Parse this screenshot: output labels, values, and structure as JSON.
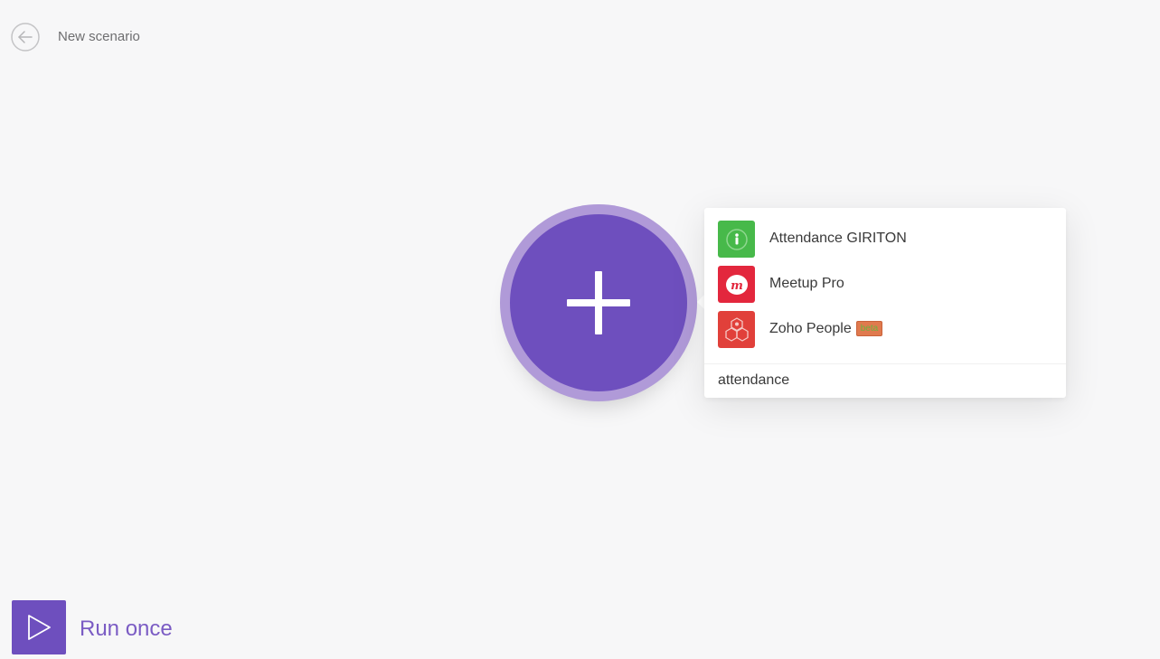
{
  "header": {
    "title": "New scenario",
    "back_icon": "arrow-left-circle-icon"
  },
  "canvas": {
    "add_module_icon": "plus-icon",
    "accent_color": "#6e4fbe"
  },
  "app_search": {
    "query": "attendance",
    "results": [
      {
        "label": "Attendance GIRITON",
        "icon": "giriton-app-icon",
        "color": "#47b94a"
      },
      {
        "label": "Meetup Pro",
        "icon": "meetup-app-icon",
        "color": "#e3273d"
      },
      {
        "label": "Zoho People",
        "icon": "zoho-people-app-icon",
        "color": "#e1403a",
        "badge": "beta"
      }
    ]
  },
  "footer": {
    "run_label": "Run once",
    "run_icon": "play-icon"
  }
}
